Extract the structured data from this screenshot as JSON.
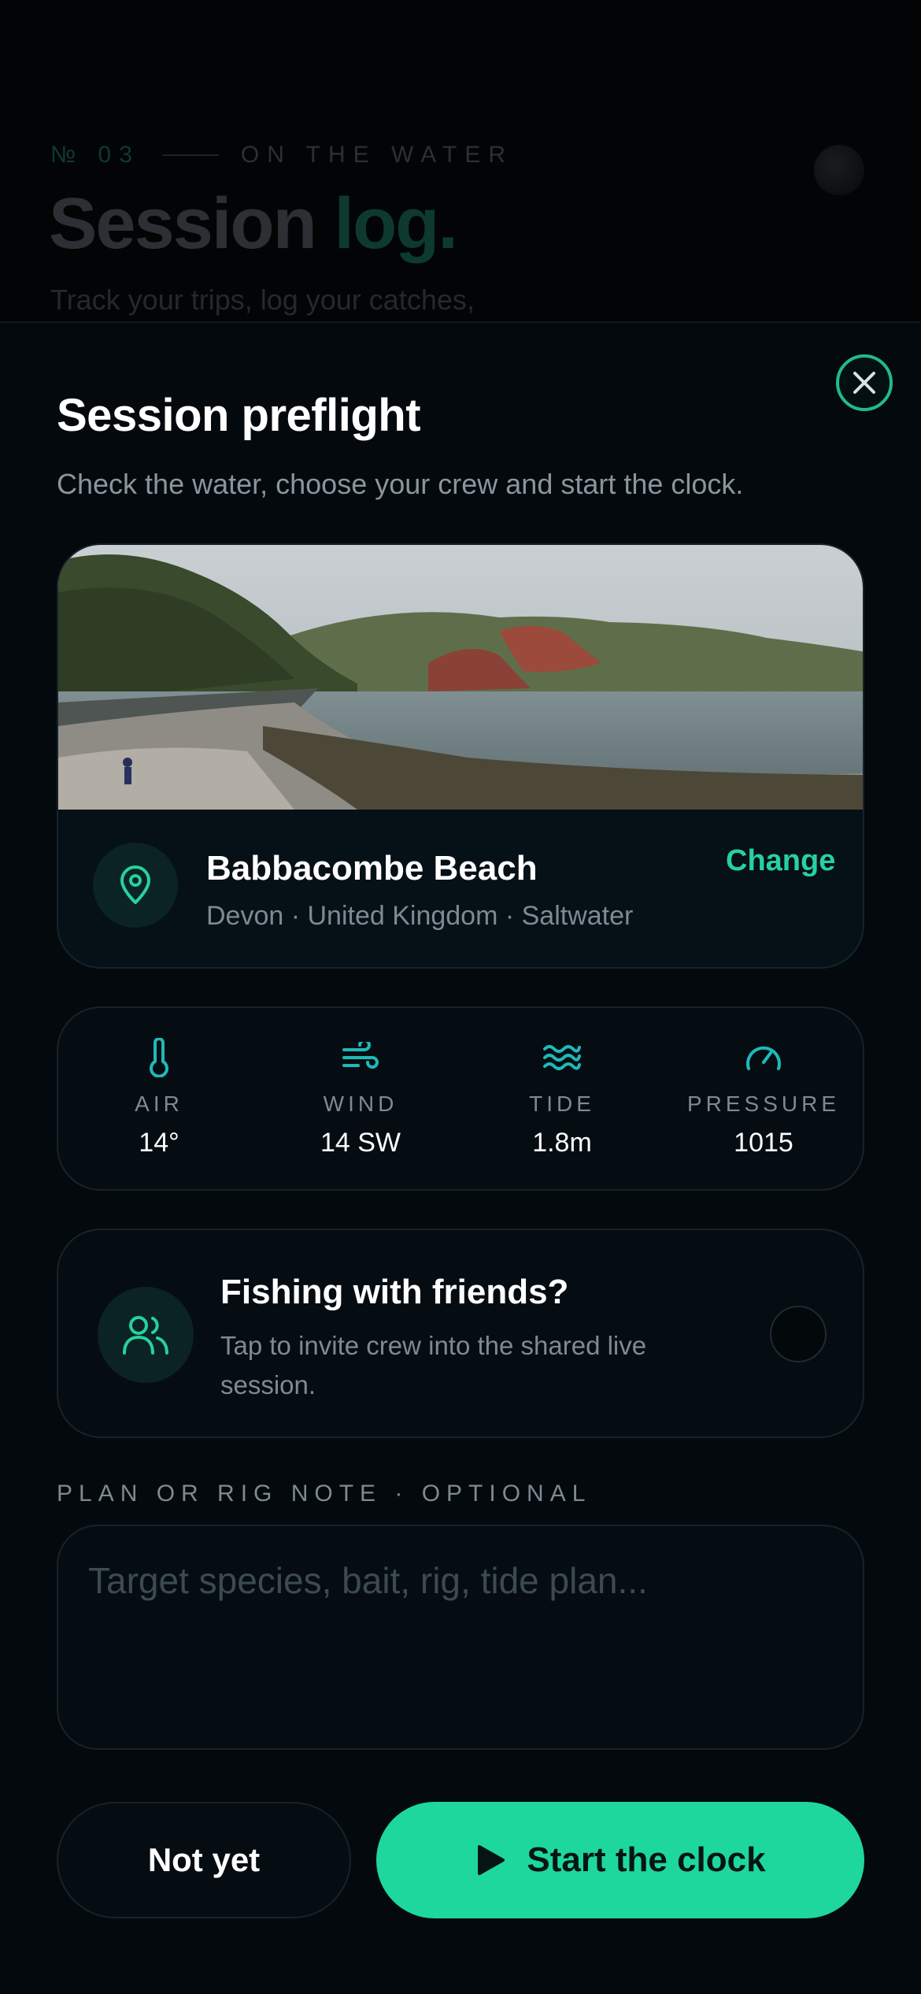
{
  "background": {
    "eyebrow_number": "№ 03",
    "eyebrow_text": "ON THE WATER",
    "title_main": "Session",
    "title_accent": "log.",
    "subtitle": "Track your trips, log your catches,"
  },
  "sheet": {
    "title": "Session preflight",
    "subtitle": "Check the water, choose your crew and start the clock.",
    "close_icon": "close-icon"
  },
  "location": {
    "name": "Babbacombe Beach",
    "meta": "Devon · United Kingdom · Saltwater",
    "change_label": "Change",
    "icon": "map-pin-icon"
  },
  "conditions": [
    {
      "label": "AIR",
      "value": "14°",
      "icon": "thermometer-icon"
    },
    {
      "label": "WIND",
      "value": "14 SW",
      "icon": "wind-icon"
    },
    {
      "label": "TIDE",
      "value": "1.8m",
      "icon": "waves-icon"
    },
    {
      "label": "PRESSURE",
      "value": "1015",
      "icon": "gauge-icon"
    }
  ],
  "friends": {
    "title": "Fishing with friends?",
    "description": "Tap to invite crew into the shared live session.",
    "icon": "users-icon",
    "enabled": false
  },
  "note": {
    "label": "PLAN OR RIG NOTE · OPTIONAL",
    "placeholder": "Target species, bait, rig, tide plan...",
    "value": ""
  },
  "actions": {
    "secondary_label": "Not yet",
    "primary_label": "Start the clock",
    "primary_icon": "play-icon"
  },
  "colors": {
    "accent": "#1ed79d",
    "sheet_background": "#03090d",
    "card_background": "#050d12",
    "muted_text": "#7e8a91"
  }
}
